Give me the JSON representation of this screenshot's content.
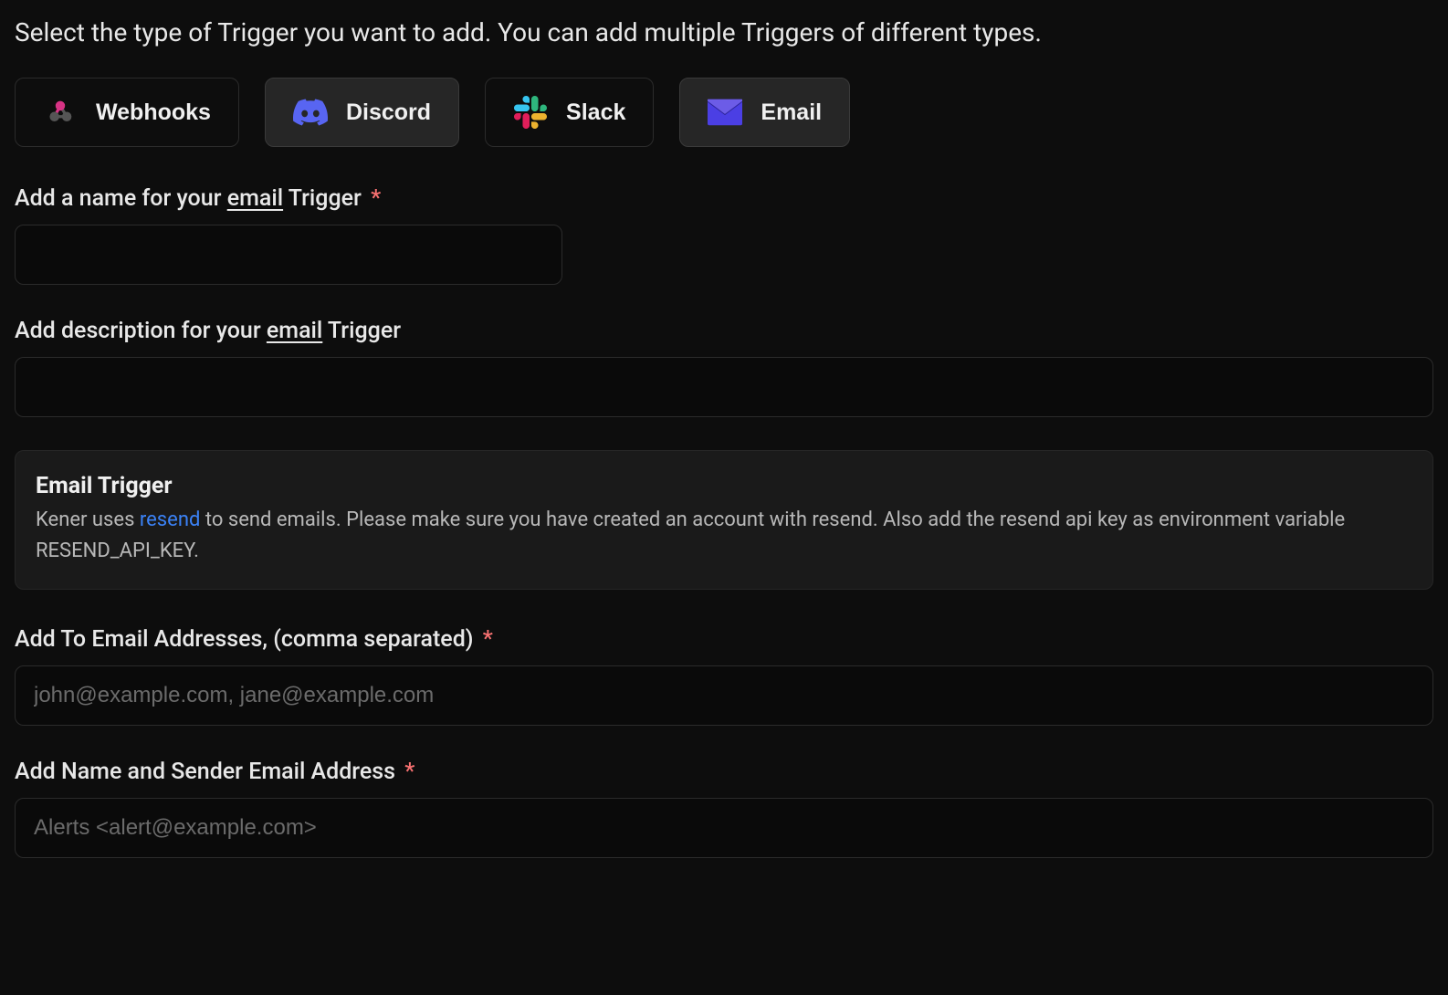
{
  "instructions": "Select the type of Trigger you want to add. You can add multiple Triggers of different types.",
  "triggerTypes": {
    "webhooks": "Webhooks",
    "discord": "Discord",
    "slack": "Slack",
    "email": "Email"
  },
  "selectedTrigger": "email",
  "form": {
    "nameLabel": {
      "prefix": "Add a name for your ",
      "underline": "email",
      "suffix": " Trigger "
    },
    "descLabel": {
      "prefix": "Add description for your ",
      "underline": "email",
      "suffix": " Trigger"
    },
    "nameValue": "",
    "descValue": ""
  },
  "infoBox": {
    "title": "Email Trigger",
    "desc1": "Kener uses ",
    "linkText": "resend",
    "desc2": " to send emails. Please make sure you have created an account with resend. Also add the resend api key as environment variable RESEND_API_KEY."
  },
  "emailFields": {
    "toLabel": "Add To Email Addresses, (comma separated) ",
    "toPlaceholder": "john@example.com, jane@example.com",
    "senderLabel": "Add Name and Sender Email Address ",
    "senderPlaceholder": "Alerts <alert@example.com>"
  },
  "requiredMark": "*"
}
